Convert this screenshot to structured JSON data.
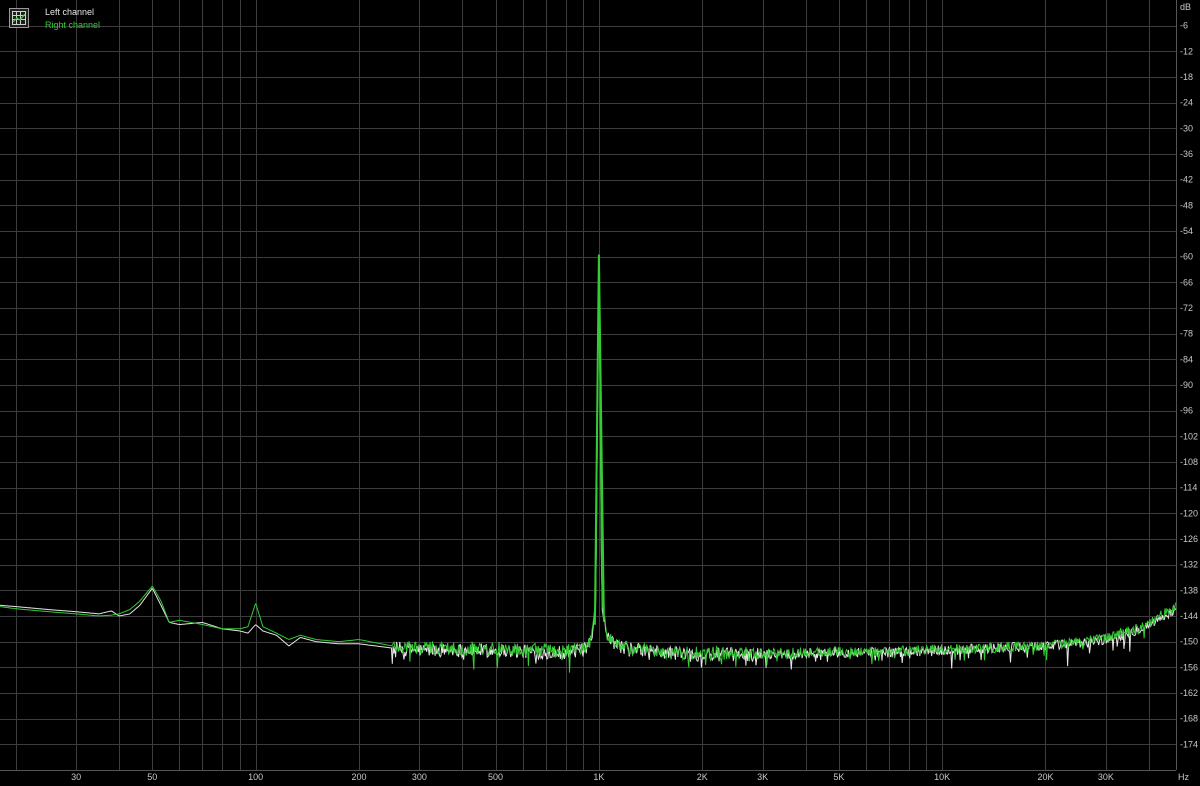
{
  "legend": {
    "left_label": "Left channel",
    "right_label": "Right channel"
  },
  "axis": {
    "y_unit": "dB",
    "x_unit": "Hz"
  },
  "colors": {
    "background": "#000000",
    "grid": "#3d3d3d",
    "axis_text": "#c8c8c8",
    "left_channel": "#e6e6e6",
    "right_channel": "#33cc33"
  },
  "chart_data": {
    "type": "line",
    "x_scale": "log",
    "xlim": [
      18,
      48000
    ],
    "ylim": [
      -180,
      0
    ],
    "grid": true,
    "legend_position": "top-left",
    "y_ticks": [
      -6,
      -12,
      -18,
      -24,
      -30,
      -36,
      -42,
      -48,
      -54,
      -60,
      -66,
      -72,
      -78,
      -84,
      -90,
      -96,
      -102,
      -108,
      -114,
      -120,
      -126,
      -132,
      -138,
      -144,
      -150,
      -156,
      -162,
      -168,
      -174
    ],
    "y_tick_labels": [
      "-6",
      "-12",
      "-18",
      "-24",
      "-30",
      "-36",
      "-42",
      "-48",
      "-54",
      "-60",
      "-66",
      "-72",
      "-78",
      "-84",
      "-90",
      "-96",
      "-102",
      "-108",
      "-114",
      "-120",
      "-126",
      "-132",
      "-138",
      "-144",
      "-150",
      "-156",
      "-162",
      "-168",
      "-174"
    ],
    "x_ticks": [
      30,
      50,
      100,
      200,
      300,
      500,
      1000,
      2000,
      3000,
      5000,
      10000,
      20000,
      30000
    ],
    "x_tick_labels": [
      "30",
      "50",
      "100",
      "200",
      "300",
      "500",
      "1K",
      "2K",
      "3K",
      "5K",
      "10K",
      "20K",
      "30K"
    ],
    "series": [
      {
        "name": "Left channel",
        "color": "#e6e6e6",
        "points": [
          [
            18,
            -141.5
          ],
          [
            20,
            -141.8
          ],
          [
            25,
            -142.5
          ],
          [
            30,
            -143.0
          ],
          [
            35,
            -143.5
          ],
          [
            38,
            -142.8
          ],
          [
            40,
            -144.0
          ],
          [
            43,
            -143.5
          ],
          [
            46,
            -141.5
          ],
          [
            50,
            -137.5
          ],
          [
            53,
            -141.5
          ],
          [
            56,
            -145.5
          ],
          [
            60,
            -146.0
          ],
          [
            70,
            -145.5
          ],
          [
            80,
            -147.0
          ],
          [
            90,
            -147.5
          ],
          [
            95,
            -148.0
          ],
          [
            100,
            -146.0
          ],
          [
            105,
            -147.5
          ],
          [
            115,
            -148.5
          ],
          [
            125,
            -151.0
          ],
          [
            135,
            -149.0
          ],
          [
            150,
            -150.0
          ],
          [
            175,
            -150.5
          ],
          [
            200,
            -150.5
          ],
          [
            250,
            -151.5
          ],
          [
            300,
            -152.0
          ],
          [
            400,
            -152.0
          ],
          [
            500,
            -152.0
          ],
          [
            600,
            -152.3
          ],
          [
            700,
            -152.5
          ],
          [
            800,
            -152.5
          ],
          [
            900,
            -152.0
          ],
          [
            950,
            -150.5
          ],
          [
            980,
            -141.0
          ],
          [
            1000,
            -59.5
          ],
          [
            1020,
            -142.0
          ],
          [
            1050,
            -148.5
          ],
          [
            1100,
            -150.5
          ],
          [
            1200,
            -151.5
          ],
          [
            1500,
            -152.5
          ],
          [
            2000,
            -153.0
          ],
          [
            3000,
            -153.0
          ],
          [
            5000,
            -152.5
          ],
          [
            7000,
            -152.5
          ],
          [
            10000,
            -152.0
          ],
          [
            15000,
            -151.5
          ],
          [
            20000,
            -151.0
          ],
          [
            25000,
            -150.5
          ],
          [
            30000,
            -149.5
          ],
          [
            35000,
            -148.0
          ],
          [
            40000,
            -146.0
          ],
          [
            45000,
            -143.8
          ],
          [
            48000,
            -142.5
          ]
        ]
      },
      {
        "name": "Right channel",
        "color": "#33cc33",
        "points": [
          [
            18,
            -141.8
          ],
          [
            20,
            -142.3
          ],
          [
            25,
            -143.0
          ],
          [
            30,
            -143.5
          ],
          [
            35,
            -144.0
          ],
          [
            38,
            -143.8
          ],
          [
            40,
            -143.5
          ],
          [
            43,
            -142.5
          ],
          [
            46,
            -140.5
          ],
          [
            50,
            -137.0
          ],
          [
            53,
            -140.5
          ],
          [
            56,
            -145.5
          ],
          [
            60,
            -145.0
          ],
          [
            70,
            -146.0
          ],
          [
            80,
            -147.0
          ],
          [
            90,
            -147.0
          ],
          [
            95,
            -146.5
          ],
          [
            100,
            -141.0
          ],
          [
            105,
            -146.5
          ],
          [
            115,
            -148.0
          ],
          [
            125,
            -149.5
          ],
          [
            135,
            -148.5
          ],
          [
            150,
            -149.5
          ],
          [
            175,
            -150.0
          ],
          [
            200,
            -149.5
          ],
          [
            250,
            -151.0
          ],
          [
            300,
            -151.5
          ],
          [
            400,
            -151.5
          ],
          [
            500,
            -151.5
          ],
          [
            600,
            -152.0
          ],
          [
            700,
            -152.0
          ],
          [
            800,
            -152.3
          ],
          [
            900,
            -151.5
          ],
          [
            950,
            -150.0
          ],
          [
            980,
            -139.5
          ],
          [
            1000,
            -59.5
          ],
          [
            1020,
            -140.5
          ],
          [
            1050,
            -148.0
          ],
          [
            1100,
            -150.0
          ],
          [
            1200,
            -151.5
          ],
          [
            1500,
            -152.5
          ],
          [
            2000,
            -152.8
          ],
          [
            3000,
            -152.8
          ],
          [
            5000,
            -152.3
          ],
          [
            7000,
            -152.3
          ],
          [
            10000,
            -151.8
          ],
          [
            15000,
            -151.3
          ],
          [
            20000,
            -150.8
          ],
          [
            25000,
            -150.2
          ],
          [
            30000,
            -149.0
          ],
          [
            35000,
            -147.5
          ],
          [
            40000,
            -145.5
          ],
          [
            45000,
            -143.2
          ],
          [
            48000,
            -142.0
          ]
        ]
      }
    ]
  }
}
